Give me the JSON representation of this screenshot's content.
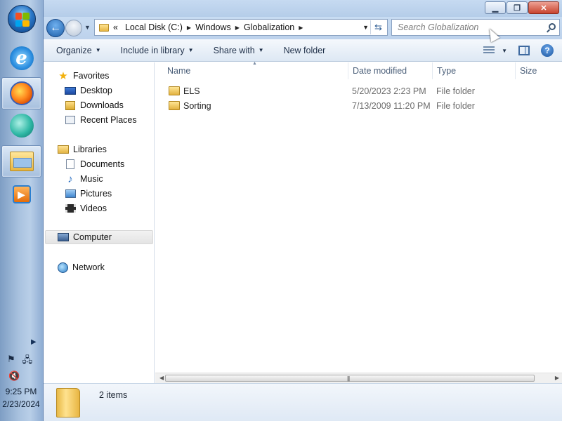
{
  "taskbar": {
    "apps": [
      "start-orb",
      "internet-explorer-icon",
      "firefox-icon",
      "live-messenger-icon",
      "windows-explorer-icon",
      "media-player-icon"
    ],
    "clock": {
      "time": "9:25 PM",
      "date": "2/23/2024"
    }
  },
  "window": {
    "title": "",
    "controls": {
      "minimize": "▁",
      "maximize": "❐",
      "close": "✕"
    }
  },
  "address": {
    "overflow": "«",
    "crumbs": [
      {
        "label": "Local Disk (C:)"
      },
      {
        "label": "Windows"
      },
      {
        "label": "Globalization"
      }
    ]
  },
  "search": {
    "placeholder": "Search Globalization",
    "value": ""
  },
  "toolbar": {
    "organize": "Organize",
    "include_in_library": "Include in library",
    "share_with": "Share with",
    "new_folder": "New folder"
  },
  "sidebar": {
    "favorites": {
      "label": "Favorites",
      "items": [
        {
          "label": "Desktop",
          "icon": "desktop-icon"
        },
        {
          "label": "Downloads",
          "icon": "downloads-icon"
        },
        {
          "label": "Recent Places",
          "icon": "recent-places-icon"
        }
      ]
    },
    "libraries": {
      "label": "Libraries",
      "items": [
        {
          "label": "Documents",
          "icon": "documents-icon"
        },
        {
          "label": "Music",
          "icon": "music-icon"
        },
        {
          "label": "Pictures",
          "icon": "pictures-icon"
        },
        {
          "label": "Videos",
          "icon": "videos-icon"
        }
      ]
    },
    "computer": {
      "label": "Computer",
      "selected": true
    },
    "network": {
      "label": "Network"
    }
  },
  "files": {
    "columns": {
      "name": "Name",
      "date": "Date modified",
      "type": "Type",
      "size": "Size"
    },
    "rows": [
      {
        "name": "ELS",
        "date": "5/20/2023 2:23 PM",
        "type": "File folder",
        "size": ""
      },
      {
        "name": "Sorting",
        "date": "7/13/2009 11:20 PM",
        "type": "File folder",
        "size": ""
      }
    ]
  },
  "status": {
    "item_count": "2 items"
  },
  "colors": {
    "accent": "#1e5fa9",
    "folder": "#e2b240",
    "taskbar": "#a9c2df"
  }
}
